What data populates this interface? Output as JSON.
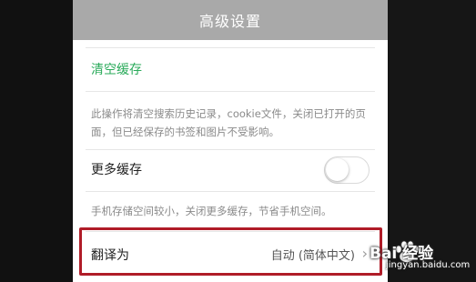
{
  "header": {
    "title": "高级设置"
  },
  "settings": {
    "clear_cache": {
      "label": "清空缓存",
      "description": "此操作将清空搜索历史记录，cookie文件，关闭已打开的页面，但已经保存的书签和图片不受影响。"
    },
    "more_cache": {
      "label": "更多缓存",
      "toggle_on": false,
      "description": "手机存储空间较小，关闭更多缓存，节省手机空间。"
    },
    "translate": {
      "label": "翻译为",
      "value": "自动 (简体中文)",
      "arrow": "›"
    }
  },
  "watermark": {
    "brand": "Bai 经验",
    "url": "jingyan.baidu.com"
  },
  "colors": {
    "accent": "#2bab5b",
    "highlight_box": "#b01c28",
    "titlebar": "#a9a9a9"
  },
  "icons": {
    "toggle": "toggle-switch-off",
    "arrow": "chevron-right-icon",
    "watermark": "baidu-paw-icon"
  }
}
